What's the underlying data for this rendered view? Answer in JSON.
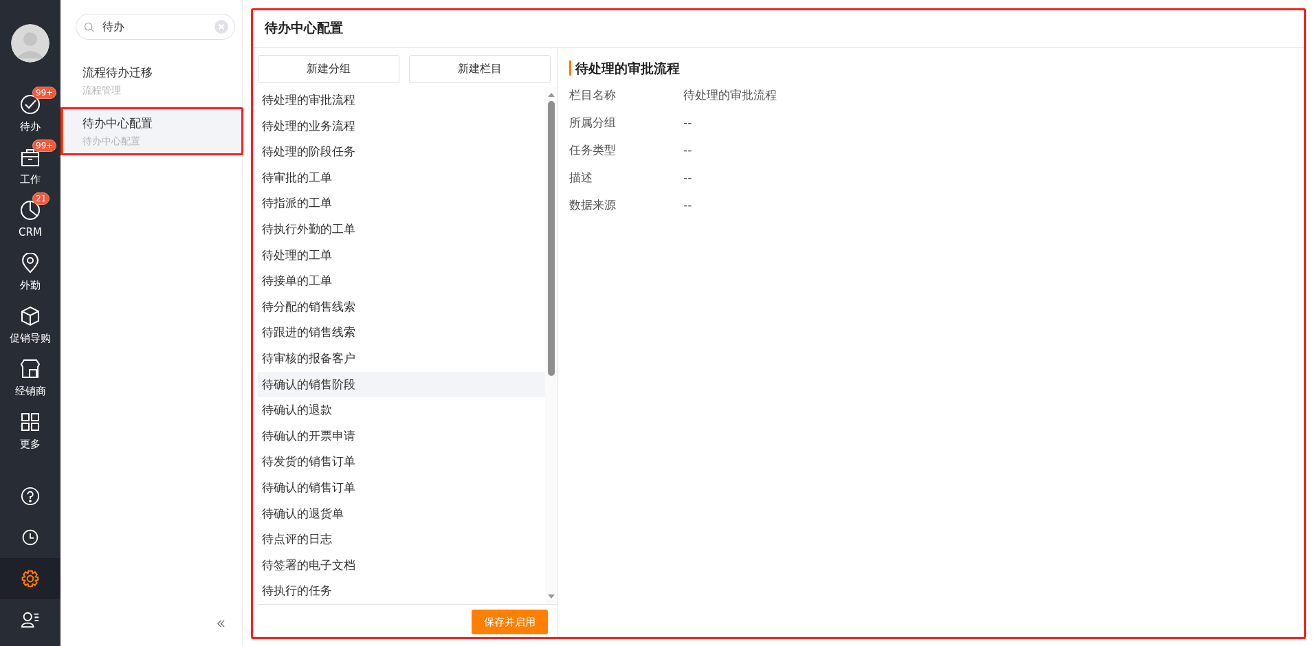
{
  "nav": {
    "items": [
      {
        "label": "待办",
        "badge": "99+"
      },
      {
        "label": "工作",
        "badge": "99+"
      },
      {
        "label": "CRM",
        "badge": "21"
      },
      {
        "label": "外勤"
      },
      {
        "label": "促销导购"
      },
      {
        "label": "经销商"
      },
      {
        "label": "更多"
      }
    ],
    "bottom_icons": [
      {
        "selected": false
      },
      {
        "selected": false
      },
      {
        "selected": true
      },
      {
        "selected": false
      }
    ]
  },
  "search": {
    "value": "待办"
  },
  "menu": [
    {
      "title": "流程待办迁移",
      "subtitle": "流程管理",
      "selected": false
    },
    {
      "title": "待办中心配置",
      "subtitle": "待办中心配置",
      "selected": true
    }
  ],
  "main": {
    "title": "待办中心配置",
    "buttons": [
      "新建分组",
      "新建栏目"
    ],
    "columns": [
      {
        "label": "待处理的审批流程",
        "selected": false
      },
      {
        "label": "待处理的业务流程",
        "selected": false
      },
      {
        "label": "待处理的阶段任务",
        "selected": false
      },
      {
        "label": "待审批的工单",
        "selected": false
      },
      {
        "label": "待指派的工单",
        "selected": false
      },
      {
        "label": "待执行外勤的工单",
        "selected": false
      },
      {
        "label": "待处理的工单",
        "selected": false
      },
      {
        "label": "待接单的工单",
        "selected": false
      },
      {
        "label": "待分配的销售线索",
        "selected": false
      },
      {
        "label": "待跟进的销售线索",
        "selected": false
      },
      {
        "label": "待审核的报备客户",
        "selected": false
      },
      {
        "label": "待确认的销售阶段",
        "selected": true
      },
      {
        "label": "待确认的退款",
        "selected": false
      },
      {
        "label": "待确认的开票申请",
        "selected": false
      },
      {
        "label": "待发货的销售订单",
        "selected": false
      },
      {
        "label": "待确认的销售订单",
        "selected": false
      },
      {
        "label": "待确认的退货单",
        "selected": false
      },
      {
        "label": "待点评的日志",
        "selected": false
      },
      {
        "label": "待签署的电子文档",
        "selected": false
      },
      {
        "label": "待执行的任务",
        "selected": false
      }
    ],
    "save_button": "保存并启用",
    "detail": {
      "heading": "待处理的审批流程",
      "fields": [
        {
          "label": "栏目名称",
          "value": "待处理的审批流程"
        },
        {
          "label": "所属分组",
          "value": "--"
        },
        {
          "label": "任务类型",
          "value": "--"
        },
        {
          "label": "描述",
          "value": "--"
        },
        {
          "label": "数据来源",
          "value": "--"
        }
      ]
    }
  }
}
